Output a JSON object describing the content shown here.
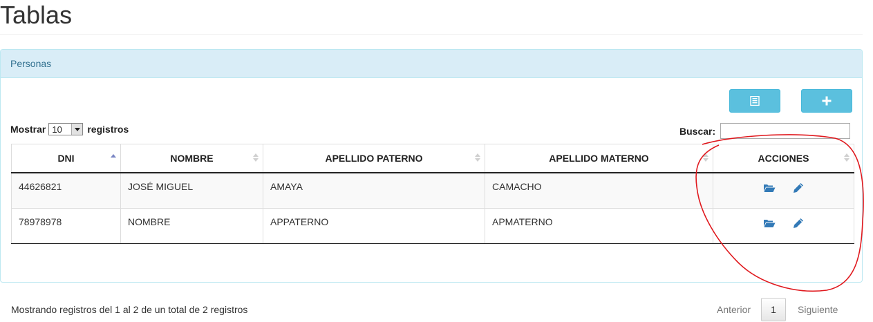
{
  "page": {
    "title": "Tablas"
  },
  "panel": {
    "heading": "Personas"
  },
  "toolbar": {
    "list_icon": "list-icon",
    "add_icon": "plus-icon",
    "button_color": "#5bc0de"
  },
  "length": {
    "prefix": "Mostrar",
    "value": "10",
    "suffix": "registros"
  },
  "search": {
    "label": "Buscar:",
    "value": ""
  },
  "table": {
    "columns": [
      "DNI",
      "NOMBRE",
      "APELLIDO PATERNO",
      "APELLIDO MATERNO",
      "ACCIONES"
    ],
    "sorted_column": "DNI",
    "rows": [
      {
        "dni": "44626821",
        "nombre": "JOSÉ MIGUEL",
        "apellido_paterno": "AMAYA",
        "apellido_materno": "CAMACHO"
      },
      {
        "dni": "78978978",
        "nombre": "NOMBRE",
        "apellido_paterno": "APPATERNO",
        "apellido_materno": "APMATERNO"
      }
    ],
    "action_icons": [
      "folder-open-icon",
      "pencil-icon"
    ],
    "action_color": "#337ab7"
  },
  "footer": {
    "info": "Mostrando registros del 1 al 2 de un total de 2 registros",
    "prev": "Anterior",
    "current_page": "1",
    "next": "Siguiente"
  },
  "annotation_color": "#e0191e"
}
